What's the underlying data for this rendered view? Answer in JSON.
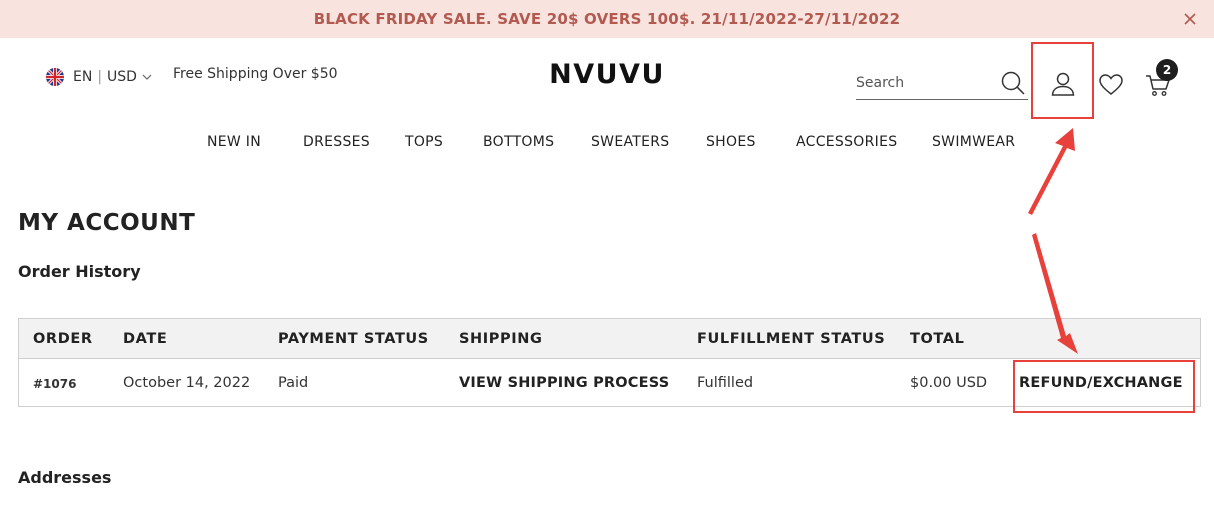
{
  "announcement": {
    "text": "BLACK FRIDAY SALE. SAVE 20$ OVERS 100$. 21/11/2022-27/11/2022",
    "close_icon": "close-icon"
  },
  "header": {
    "language": "EN",
    "currency": "USD",
    "flag_icon": "uk-flag-icon",
    "free_shipping": "Free Shipping Over $50",
    "logo": "NVUVU",
    "search_placeholder": "Search",
    "cart_count": "2",
    "icons": [
      "search-icon",
      "user-account-icon",
      "heart-wishlist-icon",
      "shopping-cart-icon"
    ]
  },
  "nav": {
    "items": [
      "NEW IN",
      "DRESSES",
      "TOPS",
      "BOTTOMS",
      "SWEATERS",
      "SHOES",
      "ACCESSORIES",
      "SWIMWEAR"
    ]
  },
  "account": {
    "title": "MY ACCOUNT",
    "order_history_title": "Order History",
    "addresses_title": "Addresses",
    "table": {
      "headers": [
        "ORDER",
        "DATE",
        "PAYMENT STATUS",
        "SHIPPING",
        "FULFILLMENT STATUS",
        "TOTAL"
      ],
      "rows": [
        {
          "order": "#1076",
          "date": "October 14, 2022",
          "payment_status": "Paid",
          "shipping": "VIEW SHIPPING PROCESS",
          "fulfillment_status": "Fulfilled",
          "total": "$0.00 USD",
          "action": "REFUND/EXCHANGE"
        }
      ]
    }
  },
  "annotations": {
    "color": "#e8403a"
  },
  "colors": {
    "announcement_bg": "#f8e3de",
    "announcement_text": "#b25a50",
    "table_header_bg": "#f2f2f2"
  }
}
